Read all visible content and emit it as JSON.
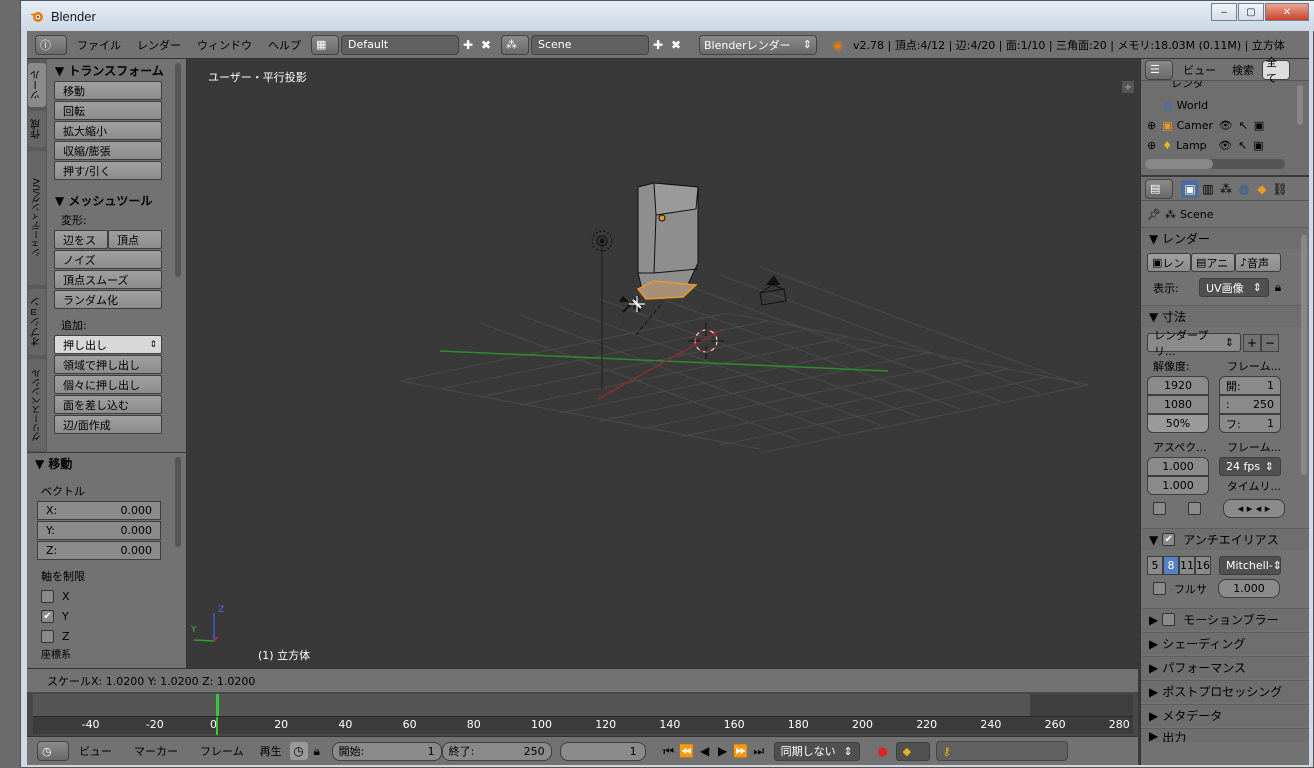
{
  "window": {
    "title": "Blender",
    "min": "‒",
    "max": "▢",
    "close": "✕"
  },
  "topbar": {
    "menus": [
      "ファイル",
      "レンダー",
      "ウィンドウ",
      "ヘルプ"
    ],
    "layout": "Default",
    "scene": "Scene",
    "engine": "Blenderレンダー",
    "info": "v2.78 | 頂点:4/12 | 辺:4/20 | 面:1/10 | 三角面:20 | メモリ:18.03M (0.11M) | 立方体"
  },
  "tool_tabs": [
    "ツール",
    "作成",
    "シェーディング/UV",
    "オプション",
    "グリースペンシル"
  ],
  "tools": {
    "transform_header": "▼ トランスフォーム",
    "transform": [
      "移動",
      "回転",
      "拡大縮小",
      "収縮/膨張",
      "押す/引く"
    ],
    "mesh_header": "▼ メッシュツール",
    "deform_label": "変形:",
    "deform_row": [
      "辺をス",
      "頂点"
    ],
    "deform": [
      "ノイズ",
      "頂点スムーズ",
      "ランダム化"
    ],
    "add_label": "追加:",
    "extrude": "押し出し",
    "add": [
      "領域で押し出し",
      "個々に押し出し",
      "面を差し込む",
      "辺/面作成"
    ]
  },
  "operator": {
    "header": "▼ 移動",
    "vector_label": "ベクトル",
    "x_label": "X:",
    "x": "0.000",
    "y_label": "Y:",
    "y": "0.000",
    "z_label": "Z:",
    "z": "0.000",
    "constraint_label": "軸を制限",
    "axes": [
      {
        "name": "X",
        "checked": false
      },
      {
        "name": "Y",
        "checked": true
      },
      {
        "name": "Z",
        "checked": false
      }
    ],
    "next_label": "座標系"
  },
  "viewport": {
    "title": "ユーザー・平行投影",
    "object": "(1) 立方体",
    "axis_y": "Y",
    "axis_z": "Z"
  },
  "status": {
    "text": "スケールX: 1.0200   Y: 1.0200  Z: 1.0200"
  },
  "timeline": {
    "ticks": [
      "-40",
      "-20",
      "0",
      "20",
      "40",
      "60",
      "80",
      "100",
      "120",
      "140",
      "160",
      "180",
      "200",
      "220",
      "240",
      "260",
      "280"
    ],
    "current": 0,
    "end": 250
  },
  "bottombar": {
    "menus": [
      "ビュー",
      "マーカー",
      "フレーム",
      "再生"
    ],
    "start_label": "開始:",
    "start": "1",
    "end_label": "終了:",
    "end": "250",
    "frame": "1",
    "sync": "同期しない"
  },
  "outliner": {
    "menus": [
      "ビュー",
      "検索",
      "全て"
    ],
    "items": [
      "レンダ",
      "World",
      "Camer",
      "Lamp"
    ]
  },
  "properties": {
    "scene": "Scene",
    "render_header": "▼ レンダー",
    "render_btns": [
      "レン",
      "アニ",
      "音声"
    ],
    "display_label": "表示:",
    "display": "UV画像",
    "dims_header": "▼ 寸法",
    "preset": "レンダープリ...",
    "res_label": "解像度:",
    "frame_label": "フレーム...",
    "res_x": "1920",
    "res_y": "1080",
    "res_pct": "50%",
    "start_label": "開:",
    "start": "1",
    "end_label": ":",
    "end": "250",
    "step_label": "フ:",
    "step": "1",
    "aspect_label": "アスペク...",
    "fps_label": "フレーム...",
    "aspect_x": "1.000",
    "aspect_y": "1.000",
    "fps": "24 fps",
    "time_label": "タイムリ...",
    "aa_header": "アンチエイリアス",
    "aa_samples": [
      "5",
      "8",
      "11",
      "16"
    ],
    "aa_filter": "Mitchell-",
    "full_label": "フルサ",
    "full_value": "1.000",
    "sections": [
      "モーションブラー",
      "シェーディング",
      "パフォーマンス",
      "ポストプロセッシング",
      "メタデータ",
      "出力"
    ]
  }
}
